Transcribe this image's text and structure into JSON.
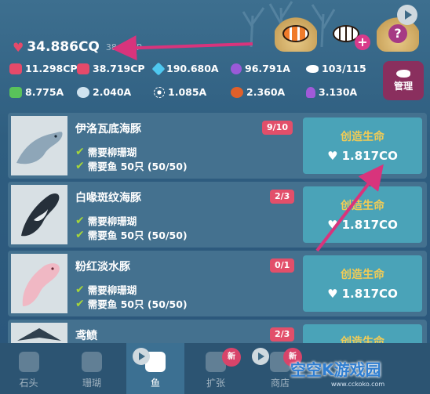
{
  "header": {
    "currency": {
      "icon": "heart-icon",
      "value": "34.886CQ",
      "rate": "38.19CP"
    }
  },
  "resources": {
    "row1": [
      {
        "icon": "hand-heart-icon",
        "value": "11.298CP",
        "color": "#e64a6a"
      },
      {
        "icon": "heart-clock-icon",
        "value": "38.719CP",
        "color": "#e64a6a"
      },
      {
        "icon": "diamond-icon",
        "value": "190.680A",
        "color": "#4ec8f0"
      },
      {
        "icon": "purple-orb-icon",
        "value": "96.791A",
        "color": "#9a5ad8"
      },
      {
        "icon": "fish-icon",
        "value": "103/115",
        "color": "#ffffff"
      }
    ],
    "row2": [
      {
        "icon": "green-bottle-icon",
        "value": "8.775A",
        "color": "#59c25a"
      },
      {
        "icon": "shell-icon",
        "value": "2.040A",
        "color": "#cfe3ef"
      },
      {
        "icon": "urchin-icon",
        "value": "1.085A",
        "color": "#ffffff"
      },
      {
        "icon": "lobster-icon",
        "value": "2.360A",
        "color": "#e0602a"
      },
      {
        "icon": "seahorse-icon",
        "value": "3.130A",
        "color": "#a15ad8"
      }
    ]
  },
  "manage_button": {
    "label": "管理"
  },
  "items": [
    {
      "name": "伊洛瓦底海豚",
      "count": "9/10",
      "req1": "需要柳珊瑚",
      "req2": "需要鱼 50只 (50/50)",
      "btn_title": "创造生命",
      "btn_price": "1.817CO"
    },
    {
      "name": "白喙斑纹海豚",
      "count": "2/3",
      "req1": "需要柳珊瑚",
      "req2": "需要鱼 50只 (50/50)",
      "btn_title": "创造生命",
      "btn_price": "1.817CO"
    },
    {
      "name": "粉红淡水豚",
      "count": "0/1",
      "req1": "需要柳珊瑚",
      "req2": "需要鱼 50只 (50/50)",
      "btn_title": "创造生命",
      "btn_price": "1.817CO"
    },
    {
      "name": "鸢鲼",
      "count": "2/3",
      "req1": "",
      "req2": "",
      "btn_title": "创造生命",
      "btn_price": ""
    }
  ],
  "nav": [
    {
      "label": "石头",
      "icon": "stone-icon",
      "badge": ""
    },
    {
      "label": "珊瑚",
      "icon": "coral-icon",
      "badge": ""
    },
    {
      "label": "鱼",
      "icon": "fish-icon",
      "badge": ""
    },
    {
      "label": "扩张",
      "icon": "expand-icon",
      "badge": "新"
    },
    {
      "label": "商店",
      "icon": "shop-icon",
      "badge": "新"
    }
  ],
  "watermark": {
    "text": "空空K游戏园",
    "url": "www.cckoko.com"
  }
}
